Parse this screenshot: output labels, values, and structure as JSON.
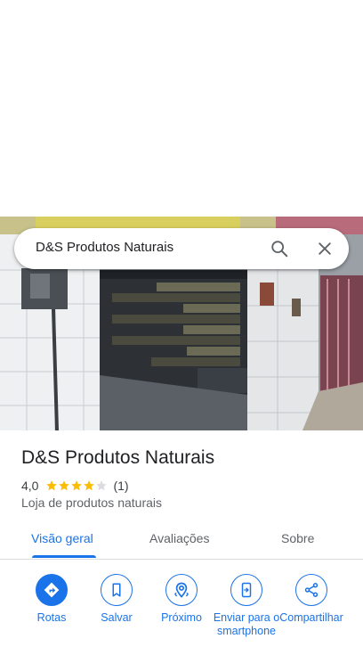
{
  "search": {
    "query": "D&S Produtos Naturais",
    "search_icon": "search-icon",
    "close_icon": "close-icon"
  },
  "place": {
    "name": "D&S Produtos Naturais",
    "rating": "4,0",
    "stars_filled": 4,
    "stars_total": 5,
    "review_count": "(1)",
    "category": "Loja de produtos naturais"
  },
  "tabs": [
    {
      "label": "Visão geral",
      "active": true
    },
    {
      "label": "Avaliações",
      "active": false
    },
    {
      "label": "Sobre",
      "active": false
    }
  ],
  "actions": [
    {
      "label": "Rotas",
      "icon": "directions-icon"
    },
    {
      "label": "Salvar",
      "icon": "bookmark-icon"
    },
    {
      "label": "Próximo",
      "icon": "nearby-icon"
    },
    {
      "label": "Enviar para o smartphone",
      "icon": "send-to-phone-icon"
    },
    {
      "label": "Compartilhar",
      "icon": "share-icon"
    }
  ],
  "colors": {
    "accent": "#1a73e8",
    "star": "#fbbc04",
    "star_empty": "#dadce0",
    "text_primary": "#202124",
    "text_secondary": "#5f6368"
  }
}
